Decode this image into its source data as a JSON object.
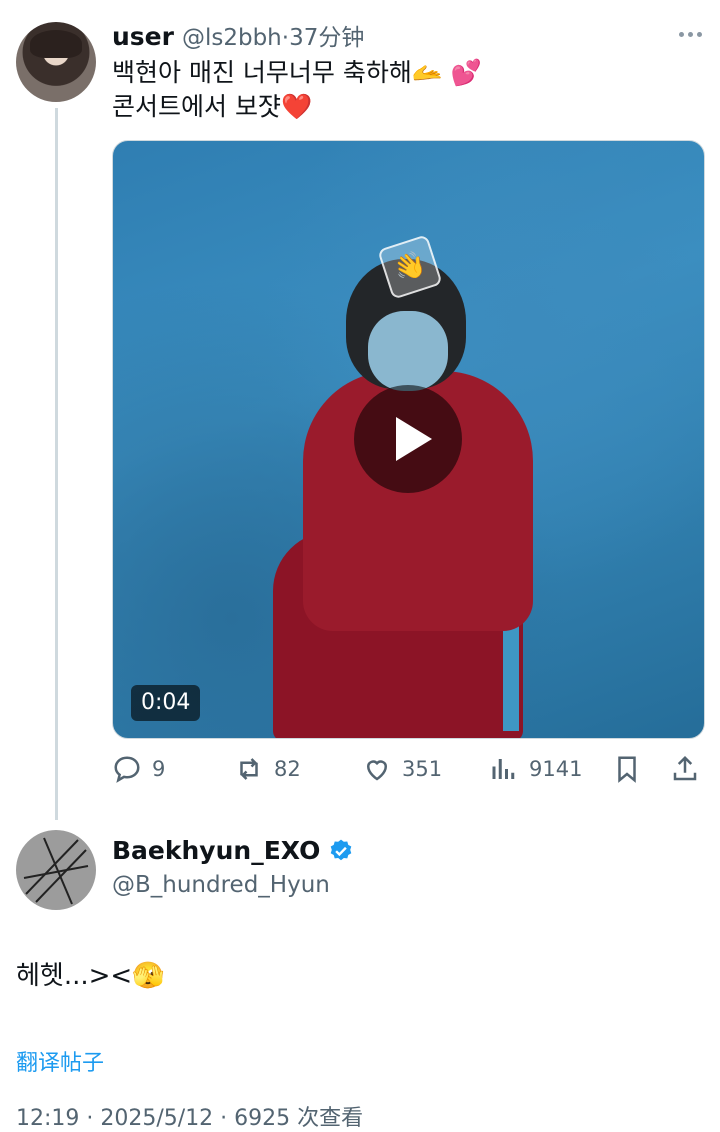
{
  "tweet": {
    "user_name": "user",
    "handle_time": "@ls2bbh·37分钟",
    "text_line1": "백현아 매진 너무너무 축하해🫴 💕",
    "text_line2": "콘서트에서 보쟛❤️",
    "video_duration": "0:04",
    "reaction_emoji": "👋",
    "stats": {
      "replies": "9",
      "retweets": "82",
      "likes": "351",
      "views": "9141"
    }
  },
  "reply": {
    "author_name": "Baekhyun_EXO",
    "author_handle": "@B_hundred_Hyun",
    "text": "헤헷...><🫣",
    "translate_label": "翻译帖子",
    "timestamp": "12:19 · 2025/5/12 · 6925 次查看"
  },
  "colors": {
    "accent": "#1d9bf0",
    "muted": "#536471",
    "verified": "#1d9bf0"
  },
  "icons": [
    "more-icon",
    "play-icon",
    "reply-icon",
    "retweet-icon",
    "like-icon",
    "views-icon",
    "bookmark-icon",
    "share-icon",
    "verified-icon"
  ]
}
